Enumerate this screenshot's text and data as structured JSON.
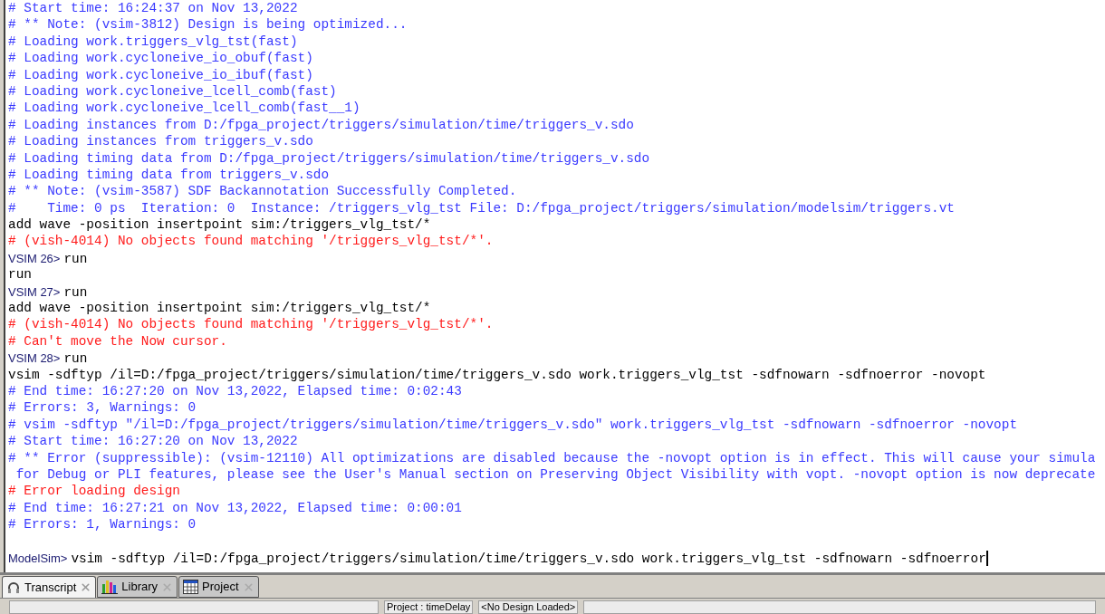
{
  "transcript": {
    "lines": [
      {
        "kind": "comment",
        "text": "# Start time: 16:24:37 on Nov 13,2022"
      },
      {
        "kind": "comment",
        "text": "# ** Note: (vsim-3812) Design is being optimized..."
      },
      {
        "kind": "comment",
        "text": "# Loading work.triggers_vlg_tst(fast)"
      },
      {
        "kind": "comment",
        "text": "# Loading work.cycloneive_io_obuf(fast)"
      },
      {
        "kind": "comment",
        "text": "# Loading work.cycloneive_io_ibuf(fast)"
      },
      {
        "kind": "comment",
        "text": "# Loading work.cycloneive_lcell_comb(fast)"
      },
      {
        "kind": "comment",
        "text": "# Loading work.cycloneive_lcell_comb(fast__1)"
      },
      {
        "kind": "comment",
        "text": "# Loading instances from D:/fpga_project/triggers/simulation/time/triggers_v.sdo"
      },
      {
        "kind": "comment",
        "text": "# Loading instances from triggers_v.sdo"
      },
      {
        "kind": "comment",
        "text": "# Loading timing data from D:/fpga_project/triggers/simulation/time/triggers_v.sdo"
      },
      {
        "kind": "comment",
        "text": "# Loading timing data from triggers_v.sdo"
      },
      {
        "kind": "comment",
        "text": "# ** Note: (vsim-3587) SDF Backannotation Successfully Completed."
      },
      {
        "kind": "comment",
        "text": "#    Time: 0 ps  Iteration: 0  Instance: /triggers_vlg_tst File: D:/fpga_project/triggers/simulation/modelsim/triggers.vt"
      },
      {
        "kind": "command",
        "text": "add wave -position insertpoint sim:/triggers_vlg_tst/*"
      },
      {
        "kind": "error",
        "text": "# (vish-4014) No objects found matching '/triggers_vlg_tst/*'."
      },
      {
        "kind": "prompt",
        "prompt": "VSIM 26>",
        "text": "run"
      },
      {
        "kind": "command",
        "text": "run"
      },
      {
        "kind": "prompt",
        "prompt": "VSIM 27>",
        "text": "run"
      },
      {
        "kind": "command",
        "text": "add wave -position insertpoint sim:/triggers_vlg_tst/*"
      },
      {
        "kind": "error",
        "text": "# (vish-4014) No objects found matching '/triggers_vlg_tst/*'."
      },
      {
        "kind": "error",
        "text": "# Can't move the Now cursor."
      },
      {
        "kind": "prompt",
        "prompt": "VSIM 28>",
        "text": "run"
      },
      {
        "kind": "command",
        "text": "vsim -sdftyp /il=D:/fpga_project/triggers/simulation/time/triggers_v.sdo work.triggers_vlg_tst -sdfnowarn -sdfnoerror -novopt"
      },
      {
        "kind": "comment",
        "text": "# End time: 16:27:20 on Nov 13,2022, Elapsed time: 0:02:43"
      },
      {
        "kind": "comment",
        "text": "# Errors: 3, Warnings: 0"
      },
      {
        "kind": "comment",
        "text": "# vsim -sdftyp \"/il=D:/fpga_project/triggers/simulation/time/triggers_v.sdo\" work.triggers_vlg_tst -sdfnowarn -sdfnoerror -novopt"
      },
      {
        "kind": "comment",
        "text": "# Start time: 16:27:20 on Nov 13,2022"
      },
      {
        "kind": "comment",
        "text": "# ** Error (suppressible): (vsim-12110) All optimizations are disabled because the -novopt option is in effect. This will cause your simula"
      },
      {
        "kind": "comment",
        "text": " for Debug or PLI features, please see the User's Manual section on Preserving Object Visibility with vopt. -novopt option is now deprecate"
      },
      {
        "kind": "error",
        "text": "# Error loading design"
      },
      {
        "kind": "comment",
        "text": "# End time: 16:27:21 on Nov 13,2022, Elapsed time: 0:00:01"
      },
      {
        "kind": "comment",
        "text": "# Errors: 1, Warnings: 0"
      },
      {
        "kind": "blank"
      }
    ],
    "input": {
      "prompt": "ModelSim>",
      "value": "vsim -sdftyp /il=D:/fpga_project/triggers/simulation/time/triggers_v.sdo work.triggers_vlg_tst -sdfnowarn -sdfnoerror",
      "cursor": true
    }
  },
  "tabs": [
    {
      "label": "Transcript",
      "kind": "transcript",
      "selected": true
    },
    {
      "label": "Library",
      "kind": "library",
      "selected": false
    },
    {
      "label": "Project",
      "kind": "project",
      "selected": false
    }
  ],
  "status_bar": [
    "Project : timeDelay",
    "<No Design Loaded>"
  ]
}
